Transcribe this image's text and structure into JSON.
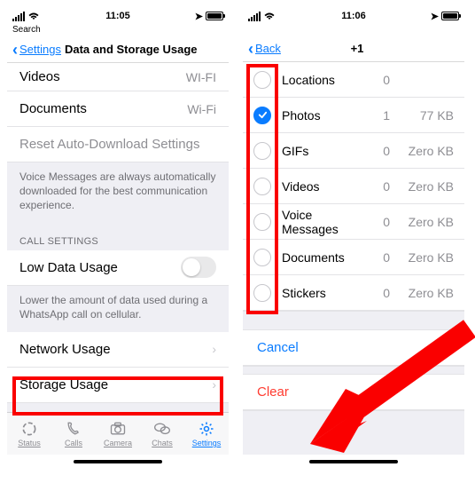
{
  "left": {
    "status_time": "11:05",
    "loc_glyph": "➤",
    "search_hint": "Search",
    "nav_back": "Settings",
    "nav_title": "Data and Storage Usage",
    "rows": {
      "videos_label": "Videos",
      "videos_value": "Wi-Fi",
      "documents_label": "Documents",
      "documents_value": "Wi-Fi",
      "reset_label": "Reset Auto-Download Settings"
    },
    "voice_note": "Voice Messages are always automatically downloaded for the best communication experience.",
    "call_header": "CALL SETTINGS",
    "low_data_label": "Low Data Usage",
    "low_data_note": "Lower the amount of data used during a WhatsApp call on cellular.",
    "network_usage_label": "Network Usage",
    "storage_usage_label": "Storage Usage",
    "tabs": {
      "status": "Status",
      "calls": "Calls",
      "camera": "Camera",
      "chats": "Chats",
      "settings": "Settings"
    }
  },
  "right": {
    "status_time": "11:06",
    "loc_glyph": "➤",
    "nav_back": "Back",
    "nav_title": "+1",
    "items": [
      {
        "label": "Locations",
        "count": "0",
        "size": "",
        "checked": false
      },
      {
        "label": "Photos",
        "count": "1",
        "size": "77 KB",
        "checked": true
      },
      {
        "label": "GIFs",
        "count": "0",
        "size": "Zero KB",
        "checked": false
      },
      {
        "label": "Videos",
        "count": "0",
        "size": "Zero KB",
        "checked": false
      },
      {
        "label": "Voice Messages",
        "count": "0",
        "size": "Zero KB",
        "checked": false
      },
      {
        "label": "Documents",
        "count": "0",
        "size": "Zero KB",
        "checked": false
      },
      {
        "label": "Stickers",
        "count": "0",
        "size": "Zero KB",
        "checked": false
      }
    ],
    "cancel": "Cancel",
    "clear": "Clear"
  },
  "annotation": {
    "arrow_color": "#fa0000"
  }
}
